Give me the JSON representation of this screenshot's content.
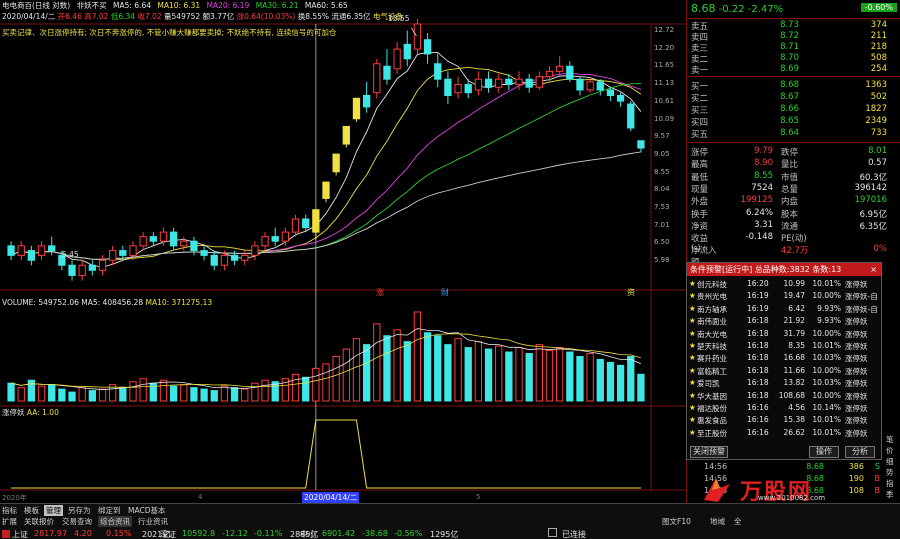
{
  "header": {
    "stock_title": "电电商百(日线 对数)",
    "indicator_label": "非妖不买",
    "ma5": "MA5: 6.64",
    "ma10": "MA10: 6.31",
    "ma20": "MA20: 6.19",
    "ma30": "MA30: 6.21",
    "ma60": "MA60: 5.65",
    "date": "2020/04/14/二",
    "open": "开6.46",
    "high": "高7.02",
    "low": "低6.34",
    "close": "收7.02",
    "volume": "量549752",
    "amount": "额3.77亿",
    "change_up": "涨0.64(10.03%)",
    "turnover": "换8.55%",
    "float": "流通6.35亿",
    "sector": "电气设备",
    "note": "买卖记律、次日涨停持有; 次日不奔涨停的, 不管小赚大赚都要卖掉; 不妖绝不持有, 连续信号的可加仓",
    "max_label": "13.55",
    "min_label": "5.45",
    "markers": [
      "涨",
      "财",
      "资"
    ]
  },
  "price_axis": [
    "12.72",
    "12.20",
    "11.65",
    "11.13",
    "10.61",
    "10.09",
    "9.57",
    "9.05",
    "8.55",
    "8.04",
    "7.53",
    "7.01",
    "6.50",
    "5.98"
  ],
  "volume_header": {
    "label": "VOLUME: 549752.06",
    "ma5": "MA5: 408456.28",
    "ma10": "MA10: 371275.13"
  },
  "ind_header": {
    "label": "涨停妖",
    "aa": "AA: 1.00"
  },
  "time_axis": {
    "year": "2020年",
    "m4": "4",
    "cursor": "2020/04/14/二",
    "m5": "5"
  },
  "quote": {
    "price": "8.68",
    "change": "-0.22",
    "pct": "-2.47%",
    "btn": "-0.60%"
  },
  "asks": [
    {
      "label": "卖五",
      "price": "8.73",
      "vol": "374"
    },
    {
      "label": "卖四",
      "price": "8.72",
      "vol": "211"
    },
    {
      "label": "卖三",
      "price": "8.71",
      "vol": "218"
    },
    {
      "label": "卖二",
      "price": "8.70",
      "vol": "508"
    },
    {
      "label": "卖一",
      "price": "8.69",
      "vol": "254"
    }
  ],
  "bids": [
    {
      "label": "买一",
      "price": "8.68",
      "vol": "1363"
    },
    {
      "label": "买二",
      "price": "8.67",
      "vol": "502"
    },
    {
      "label": "买三",
      "price": "8.66",
      "vol": "1827"
    },
    {
      "label": "买四",
      "price": "8.65",
      "vol": "2349"
    },
    {
      "label": "买五",
      "price": "8.64",
      "vol": "733"
    }
  ],
  "stats": [
    {
      "l1": "涨停",
      "v1": "9.79",
      "c1": "red",
      "l2": "跌停",
      "v2": "8.01",
      "c2": "green"
    },
    {
      "l1": "最高",
      "v1": "8.90",
      "c1": "red",
      "l2": "量比",
      "v2": "0.57",
      "c2": "white"
    },
    {
      "l1": "最低",
      "v1": "8.55",
      "c1": "green",
      "l2": "市值",
      "v2": "60.3亿",
      "c2": "white"
    },
    {
      "l1": "现量",
      "v1": "7524",
      "c1": "white",
      "l2": "总量",
      "v2": "396142",
      "c2": "white"
    },
    {
      "l1": "外盘",
      "v1": "199125",
      "c1": "red",
      "l2": "内盘",
      "v2": "197016",
      "c2": "green"
    },
    {
      "l1": "换手",
      "v1": "6.24%",
      "c1": "white",
      "l2": "股本",
      "v2": "6.95亿",
      "c2": "white"
    },
    {
      "l1": "净资",
      "v1": "3.31",
      "c1": "white",
      "l2": "流通",
      "v2": "6.35亿",
      "c2": "white"
    },
    {
      "l1": "收益(-)",
      "v1": "-0.148",
      "c1": "white",
      "l2": "PE(动)",
      "v2": "",
      "c2": "white"
    },
    {
      "l1": "净流入额",
      "v1": "",
      "c1": "white",
      "l2": "42.7万",
      "v2": "0%",
      "c2": "red"
    }
  ],
  "alert": {
    "title": "条件预警[运行中] 总品种数:3832 条数:13",
    "close_btn": "×",
    "rows": [
      {
        "name": "创元科技",
        "time": "16:20",
        "price": "10.99",
        "pct": "10.01%",
        "type": "涨停妖"
      },
      {
        "name": "贵州光电",
        "time": "16:19",
        "price": "19.47",
        "pct": "10.00%",
        "type": "涨停妖-自"
      },
      {
        "name": "南方轴承",
        "time": "16:19",
        "price": "6.42",
        "pct": "9.93%",
        "type": "涨停妖-自"
      },
      {
        "name": "南伟面业",
        "time": "16:18",
        "price": "21.92",
        "pct": "9.93%",
        "type": "涨停妖"
      },
      {
        "name": "南大光电",
        "time": "16:18",
        "price": "31.79",
        "pct": "10.00%",
        "type": "涨停妖"
      },
      {
        "name": "楚天科技",
        "time": "16:18",
        "price": "8.35",
        "pct": "10.01%",
        "type": "涨停妖"
      },
      {
        "name": "赛升药业",
        "time": "16:18",
        "price": "16.68",
        "pct": "10.03%",
        "type": "涨停妖"
      },
      {
        "name": "富临精工",
        "time": "16:18",
        "price": "11.66",
        "pct": "10.00%",
        "type": "涨停妖"
      },
      {
        "name": "爱司凯",
        "time": "16:18",
        "price": "13.82",
        "pct": "10.03%",
        "type": "涨停妖"
      },
      {
        "name": "华大基因",
        "time": "16:18",
        "price": "108.68",
        "pct": "10.00%",
        "type": "涨停妖"
      },
      {
        "name": "福达股份",
        "time": "16:16",
        "price": "4.56",
        "pct": "10.14%",
        "type": "涨停妖"
      },
      {
        "name": "惠发食品",
        "time": "16:16",
        "price": "15.38",
        "pct": "10.01%",
        "type": "涨停妖"
      },
      {
        "name": "至正股份",
        "time": "16:16",
        "price": "26.62",
        "pct": "10.01%",
        "type": "涨停妖"
      }
    ],
    "btn_close_alert": "关闭预警",
    "btn_action": "操作",
    "btn_analysis": "分析"
  },
  "ticks": [
    {
      "time": "14:56",
      "price": "8.68",
      "vol": "386",
      "side": "S"
    },
    {
      "time": "14:56",
      "price": "8.68",
      "vol": "190",
      "side": "B"
    },
    {
      "time": "14:56",
      "price": "8.68",
      "vol": "108",
      "side": "B"
    }
  ],
  "side_labels": [
    "笔",
    "价",
    "细",
    "势",
    "指",
    "季"
  ],
  "watermark": {
    "brand": "万股网",
    "url": "www.2010082.com"
  },
  "bottom_tabs": [
    "指标",
    "模板",
    "管理",
    "另存为",
    "绑定到",
    "MACD基本"
  ],
  "bottom_tabs2": [
    "扩展",
    "关联报价",
    "交易查询",
    "综合资讯",
    "行业资讯"
  ],
  "right_tabs": [
    "图文F10",
    "地域",
    "全"
  ],
  "indices": [
    {
      "name": "上证",
      "value": "2817.97",
      "chg": "4.20",
      "pct": "0.15%",
      "amt": "2021亿",
      "cls": "red"
    },
    {
      "name": "深证",
      "value": "10592.8",
      "chg": "-12.12",
      "pct": "-0.11%",
      "amt": "2885亿",
      "cls": "green"
    },
    {
      "name": "中小",
      "value": "6901.42",
      "chg": "-38.68",
      "pct": "-0.56%",
      "amt": "1295亿",
      "cls": "green"
    }
  ],
  "connection": "已连接",
  "colors": {
    "up": "#ff3b3b",
    "down": "#3ee6e6",
    "ma5": "#e6e6e6",
    "ma10": "#f0e040",
    "ma20": "#e040e0",
    "ma30": "#2bd12b",
    "ma60": "#cccccc",
    "panel_border": "#7a1010"
  }
}
